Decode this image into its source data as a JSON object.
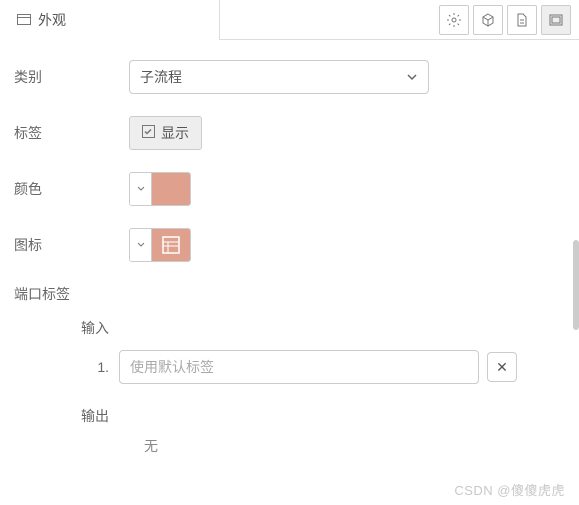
{
  "tab": {
    "title": "外观"
  },
  "toolbar": {
    "icons": [
      "gear",
      "cube",
      "document",
      "layout"
    ]
  },
  "form": {
    "category": {
      "label": "类别",
      "value": "子流程"
    },
    "tag": {
      "label": "标签",
      "button": "显示"
    },
    "color": {
      "label": "颜色",
      "value": "#dfa08d"
    },
    "icon": {
      "label": "图标"
    },
    "portLabels": {
      "label": "端口标签",
      "input": {
        "label": "输入",
        "items": [
          {
            "index": "1.",
            "placeholder": "使用默认标签"
          }
        ]
      },
      "output": {
        "label": "输出",
        "none": "无"
      }
    }
  },
  "watermark": "CSDN @傻傻虎虎"
}
